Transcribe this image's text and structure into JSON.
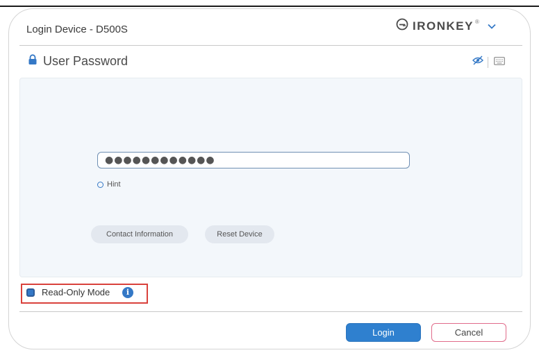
{
  "window": {
    "title": "Login Device - D500S",
    "brand": "IRONKEY",
    "brand_mark": "®"
  },
  "section": {
    "title": "User Password"
  },
  "password": {
    "value": "●●●●●●●●●●●●"
  },
  "hint": {
    "label": "Hint"
  },
  "links": {
    "contact": "Contact Information",
    "reset": "Reset Device"
  },
  "read_only": {
    "label": "Read-Only Mode",
    "info_glyph": "i",
    "checked": true
  },
  "actions": {
    "login": "Login",
    "cancel": "Cancel"
  },
  "colors": {
    "accent": "#2f80cf",
    "highlight_box": "#d9413b",
    "cancel_border": "#e06b8a",
    "panel_bg": "#f3f7fb"
  },
  "icons": [
    "ironkey-logo-icon",
    "chevron-down-icon",
    "lock-icon",
    "eye-hidden-icon",
    "keyboard-icon",
    "info-icon"
  ]
}
